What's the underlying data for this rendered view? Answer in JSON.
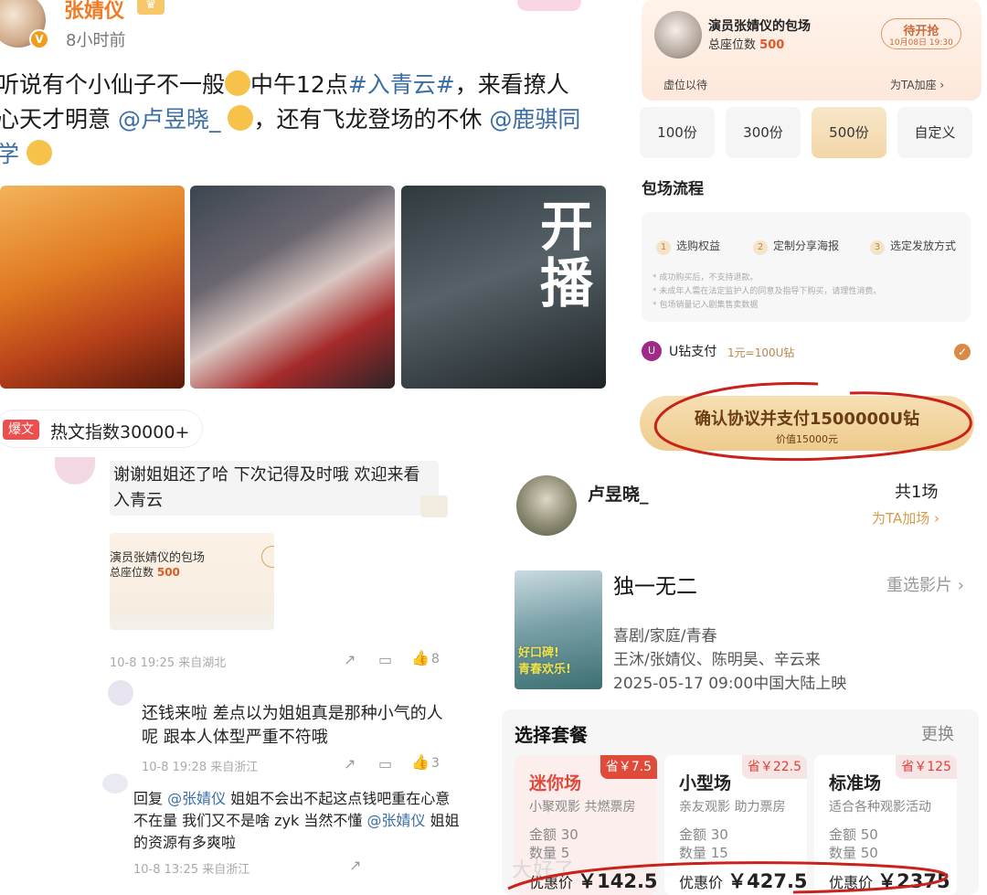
{
  "post": {
    "username": "张婧仪",
    "verified_mark": "V",
    "crown": "♛",
    "time": "8小时前",
    "text": {
      "line1_a": "听说有个小仙子不一般",
      "line1_b": "中午12点",
      "line1_hashtag": "#入青云#",
      "line1_c": "，来看撩人",
      "line2_a": "心天才明意",
      "line2_mention": "@卢昱晓_",
      "line2_b": "，还有飞龙登场的不休",
      "line2_mention2": "@鹿骐同",
      "line3": "学"
    },
    "photo3_caption": "开播",
    "hot_tag_pill": "爆文",
    "hot_tag_text": "热文指数30000+"
  },
  "comments": [
    {
      "text": "谢谢姐姐还了哈 下次记得及时哦 欢迎来看入青云",
      "image_title": "演员张婧仪的包场",
      "image_seats_label": "总座位数",
      "image_seats_value": "500",
      "meta": "10-8 19:25 来自湖北",
      "likes": "8"
    },
    {
      "text": "还钱来啦 差点以为姐姐真是那种小气的人呢 跟本人体型严重不符哦",
      "meta": "10-8 19:28 来自浙江",
      "likes": "3"
    },
    {
      "prefix": "回复",
      "mention": "@张婧仪",
      "text": "姐姐不会出不起这点钱吧重在心意不在量 我们又不是啥 zyk 当然不懂",
      "mention2": "@张婧仪",
      "text2": "姐姐的资源有多爽啦",
      "meta": "10-8 13:25 来自浙江"
    }
  ],
  "booking": {
    "title": "演员张婧仪的包场",
    "seats_label": "总座位数",
    "seats_value": "500",
    "status_label": "待开抢",
    "status_time": "10月08日 19:30",
    "left_label": "虚位以待",
    "right_label": "为TA加座 ›",
    "amounts": [
      "100份",
      "300份",
      "500份",
      "自定义"
    ],
    "flow_title": "包场流程",
    "steps": [
      "选购权益",
      "定制分享海报",
      "选定发放方式"
    ],
    "notes": [
      "* 成功购买后，不支持退款。",
      "* 未成年人需在法定监护人的同意及指导下购买，请理性消费。",
      "* 包场销量记入剧集售卖数据"
    ],
    "pay_label": "U钻支付",
    "pay_rate": "1元=100U钻",
    "confirm_label": "确认协议并支付1500000U钻",
    "confirm_sub": "价值15000元"
  },
  "user": {
    "name": "卢昱晓_",
    "count": "共1场",
    "add": "为TA加场 ›"
  },
  "movie": {
    "title": "独一无二",
    "reselect": "重选影片 ›",
    "genre": "喜剧/家庭/青春",
    "cast": "王沐/张婧仪、陈明昊、辛云来",
    "date": "2025-05-17 09:00中国大陆上映",
    "poster_text": "好口碑!\n青春欢乐!",
    "packages_title": "选择套餐",
    "change": "更换",
    "packages": [
      {
        "name": "迷你场",
        "save": "省￥7.5",
        "desc": "小聚观影 共燃票房",
        "amount": "金额 30",
        "qty": "数量 5",
        "price_label": "优惠价",
        "price": "￥142.5"
      },
      {
        "name": "小型场",
        "save": "省￥22.5",
        "desc": "亲友观影 助力票房",
        "amount": "金额 30",
        "qty": "数量 15",
        "price_label": "优惠价",
        "price": "￥427.5"
      },
      {
        "name": "标准场",
        "save": "省￥125",
        "desc": "适合各种观影活动",
        "amount": "金额 50",
        "qty": "数量 50",
        "price_label": "优惠价",
        "price": "￥2375"
      }
    ]
  },
  "watermark": "大好了",
  "colors": {
    "accent_orange": "#f07b22",
    "link_blue": "#3a6ea5",
    "annotation_red": "#c8221a",
    "gold": "#eecb8c"
  }
}
